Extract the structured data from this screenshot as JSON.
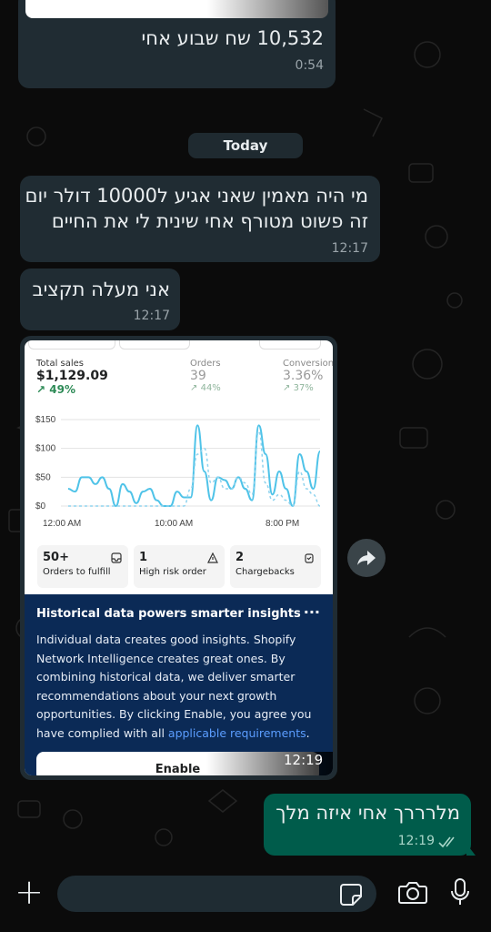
{
  "messages": [
    {
      "id": "m1",
      "dir": "in",
      "text": "10,532 שח שבוע אחי",
      "time": "0:54"
    },
    {
      "id": "m2",
      "dir": "in",
      "lines": [
        "מי היה מאמין שאני אגיע ל10000 דולר יום",
        "זה פשוט מטורף אחי שינית לי את החיים"
      ],
      "time": "12:17"
    },
    {
      "id": "m3",
      "dir": "in",
      "text": "אני מעלה תקציב",
      "time": "12:17"
    },
    {
      "id": "m4",
      "dir": "in",
      "kind": "image",
      "time": "12:19"
    },
    {
      "id": "m5",
      "dir": "out",
      "text": "מלרררך אחי איזה מלך",
      "time": "12:19"
    }
  ],
  "day_separator": "Today",
  "screenshot": {
    "stats": [
      {
        "label": "Total sales",
        "value": "$1,129.09",
        "change": "49%"
      },
      {
        "label": "Orders",
        "value": "39",
        "change": "44%"
      },
      {
        "label": "Conversion",
        "value": "3.36%",
        "change": "37%"
      }
    ],
    "cards": [
      {
        "value": "50+",
        "label": "Orders to fulfill",
        "icon": "inbox-icon"
      },
      {
        "value": "1",
        "label": "High risk order",
        "icon": "warning-icon"
      },
      {
        "value": "2",
        "label": "Chargebacks",
        "icon": "chargeback-icon"
      }
    ],
    "insight": {
      "title": "Historical data powers smarter insights",
      "menu": "···",
      "body": "Individual data creates good insights. Shopify Network Intelligence creates great ones. By combining historical data, we deliver smarter recommendations about your next growth opportunities. By clicking Enable, you agree you have complied with all ",
      "link": "applicable requirements",
      "body_end": ".",
      "button": "Enable"
    }
  },
  "chart_data": {
    "type": "line",
    "x": [
      "12:00 AM",
      "",
      "",
      "",
      "",
      "",
      "",
      "",
      "",
      "",
      "10:00 AM",
      "",
      "",
      "",
      "",
      "",
      "",
      "",
      "",
      "",
      "8:00 PM",
      "",
      "",
      ""
    ],
    "xticks": [
      "12:00 AM",
      "10:00 AM",
      "8:00 PM"
    ],
    "yticks": [
      "$0",
      "$50",
      "$100",
      "$150"
    ],
    "ylim": [
      0,
      150
    ],
    "series": [
      {
        "values": [
          30,
          25,
          50,
          50,
          38,
          50,
          30,
          0,
          38,
          25,
          5,
          25,
          30,
          10,
          0,
          0,
          25,
          15,
          15,
          140,
          60,
          10,
          50,
          45,
          30,
          50,
          30,
          10,
          140,
          90,
          20,
          60,
          30,
          0,
          90,
          60,
          30,
          95
        ],
        "style": "solid",
        "color": "#4fc3e8"
      },
      {
        "values": [
          0,
          0,
          0,
          0,
          0,
          0,
          0,
          0,
          0,
          0,
          0,
          0,
          0,
          0,
          0,
          0,
          0,
          0,
          30,
          90,
          100,
          40,
          50,
          30,
          30,
          50,
          40,
          20,
          130,
          40,
          10,
          20,
          10,
          0,
          60,
          30,
          20,
          0
        ],
        "style": "dashed",
        "color": "#8fd3ee"
      }
    ]
  },
  "footer": {
    "plus": "+",
    "input_placeholder": ""
  },
  "colors": {
    "incoming": "#202c33",
    "outgoing": "#005c4b",
    "accent": "#53bdeb"
  }
}
